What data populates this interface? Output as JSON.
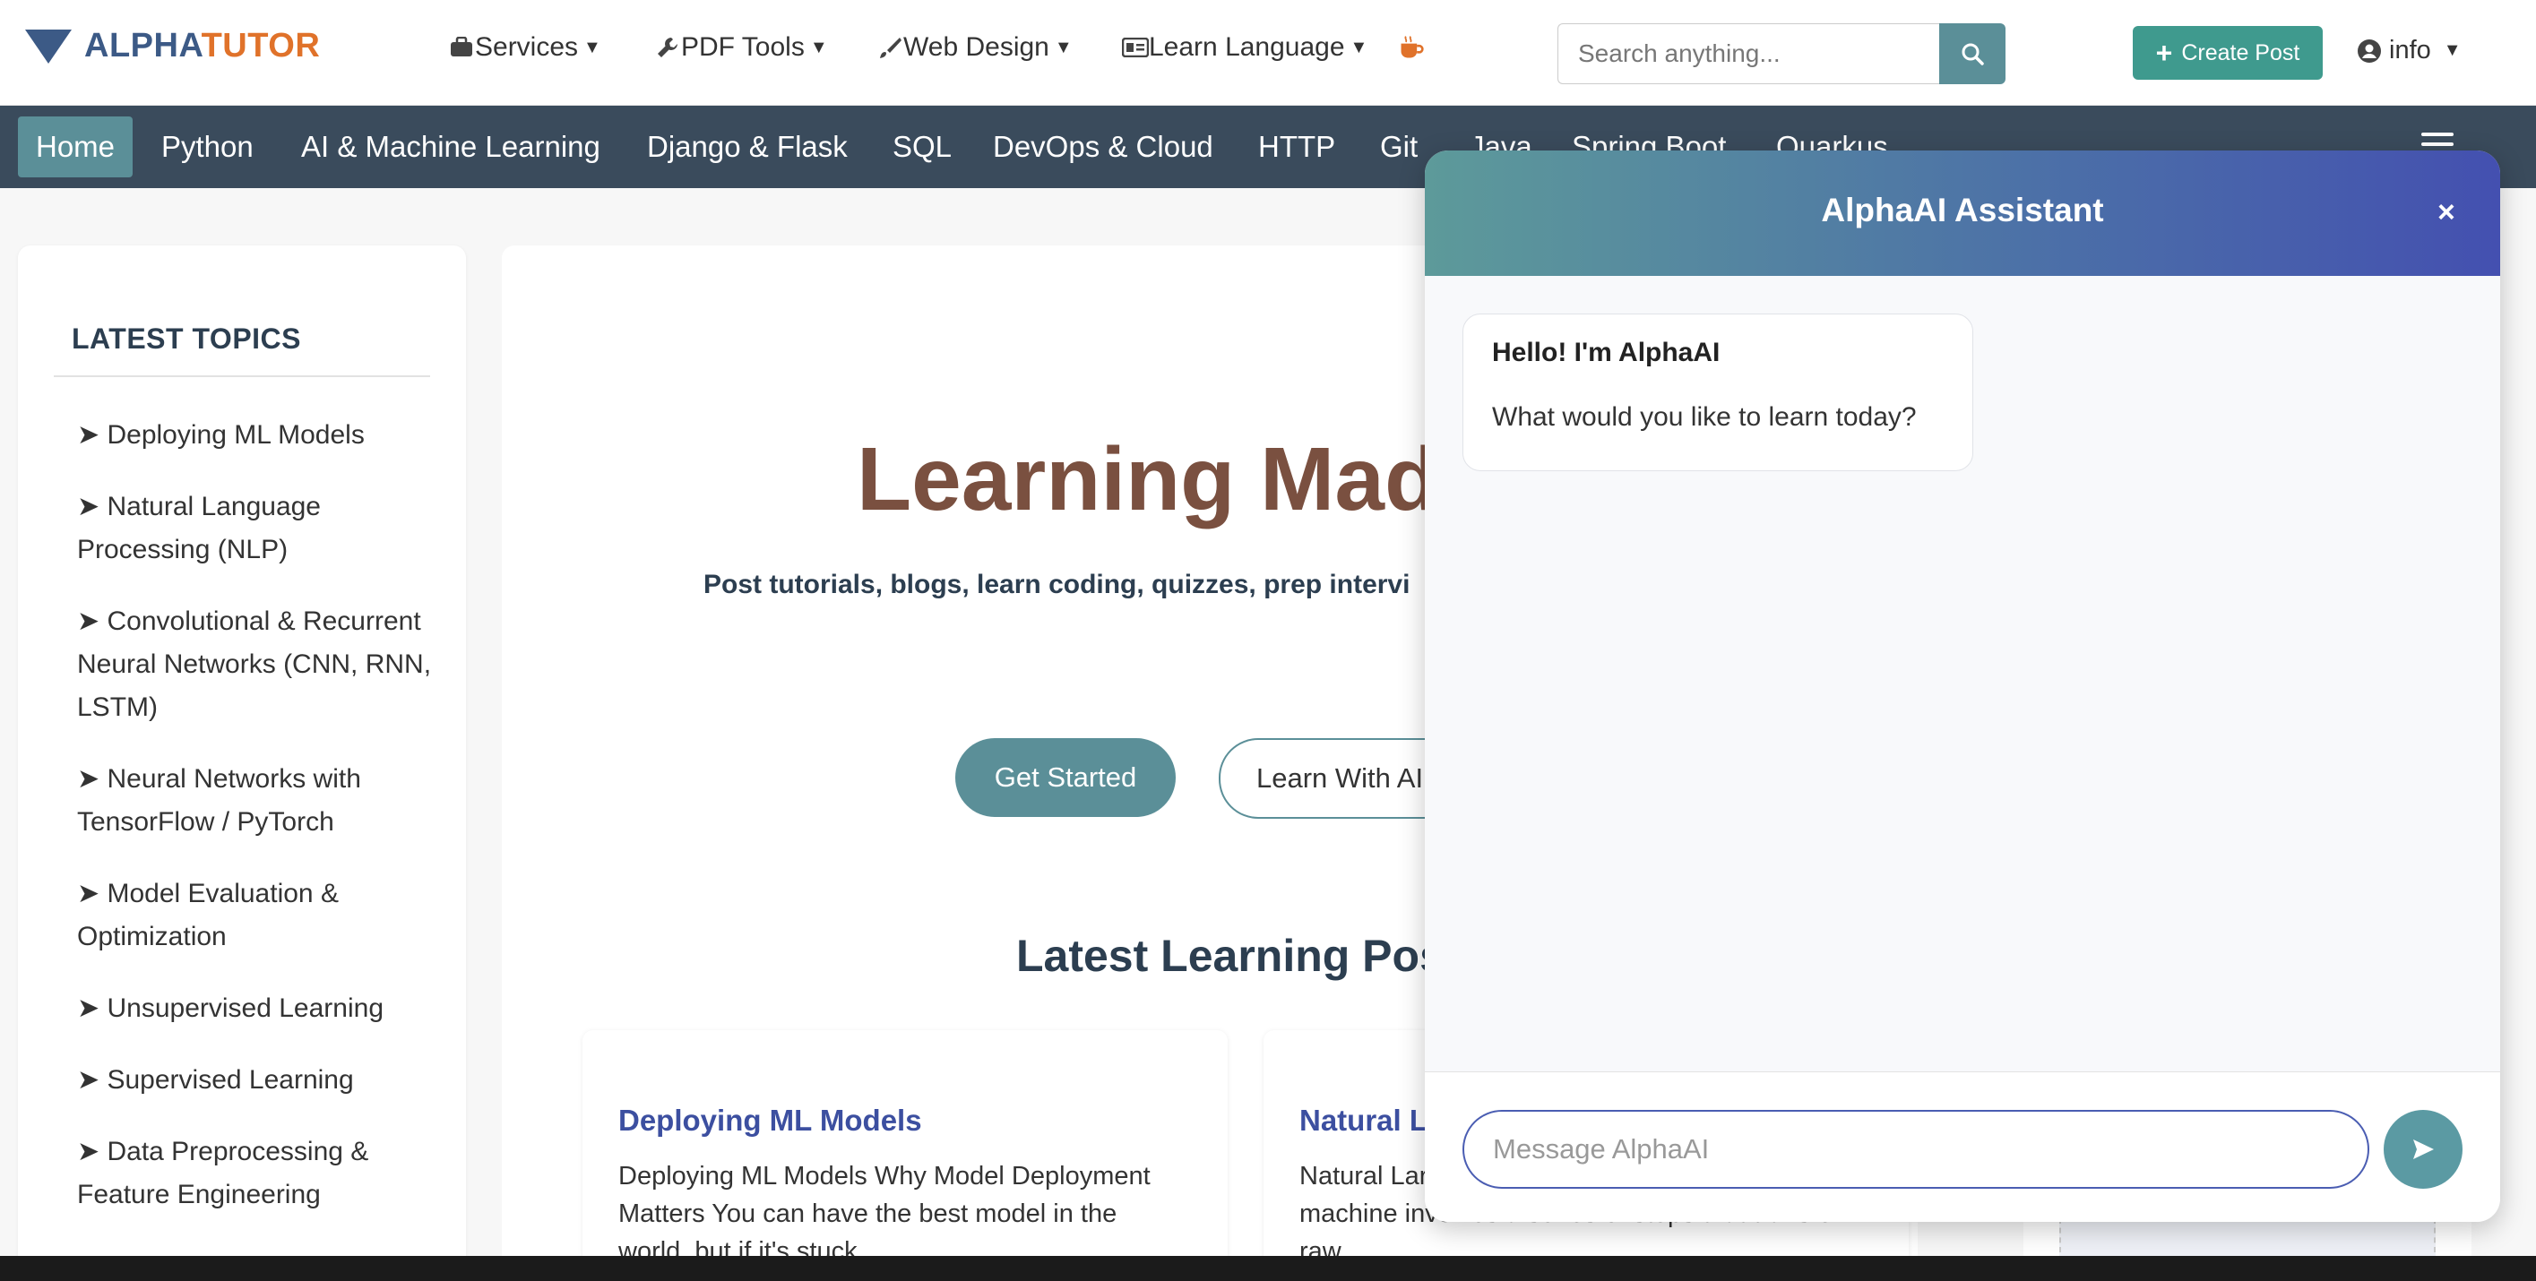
{
  "brand": {
    "part1": "ALPHA",
    "part2": "TUTOR"
  },
  "topmenu": [
    {
      "label": "Services",
      "icon": "briefcase-icon"
    },
    {
      "label": "PDF Tools",
      "icon": "wrench-icon"
    },
    {
      "label": "Web Design",
      "icon": "brush-icon"
    },
    {
      "label": "Learn Language",
      "icon": "language-card-icon"
    }
  ],
  "search": {
    "placeholder": "Search anything..."
  },
  "create_post": "Create Post",
  "user_menu": "info",
  "categories": [
    "Home",
    "Python",
    "AI & Machine Learning",
    "Django & Flask",
    "SQL",
    "DevOps & Cloud",
    "HTTP",
    "Git",
    "Java",
    "Spring Boot",
    "Quarkus"
  ],
  "sidebar": {
    "title": "LATEST TOPICS",
    "topics": [
      "➤ Deploying ML Models",
      "➤ Natural Language Processing (NLP)",
      "➤ Convolutional & Recurrent Neural Networks (CNN, RNN, LSTM)",
      "➤ Neural Networks with TensorFlow / PyTorch",
      "➤ Model Evaluation & Optimization",
      "➤ Unsupervised Learning",
      "➤ Supervised Learning",
      "➤ Data Preprocessing & Feature Engineering"
    ]
  },
  "hero": {
    "title": "Learning Made",
    "subtitle": "Post tutorials, blogs, learn coding, quizzes, prep intervi",
    "get_started": "Get Started",
    "learn_ai": "Learn With AI"
  },
  "latest_posts": {
    "title": "Latest Learning Pos",
    "cards": [
      {
        "title": "Deploying ML Models",
        "excerpt": "Deploying ML Models Why Model Deployment Matters You can have the best model in the world, but if it's stuck"
      },
      {
        "title": "Natural L",
        "excerpt": "Natural Lar Pipeline Processing language for a machine involves a series of steps that transform raw"
      }
    ]
  },
  "chat": {
    "title": "AlphaAI Assistant",
    "close": "×",
    "greeting": "Hello! I'm AlphaAI",
    "message": "What would you like to learn today?",
    "input_placeholder": "Message AlphaAI"
  },
  "colors": {
    "teal": "#5b8f98",
    "navbar": "#3a4b5c",
    "brand_blue": "#3c5a86",
    "brand_orange": "#e0722a",
    "create_green": "#3f9a8e",
    "hero_brown": "#7a5040",
    "card_title": "#3c4fa0"
  }
}
